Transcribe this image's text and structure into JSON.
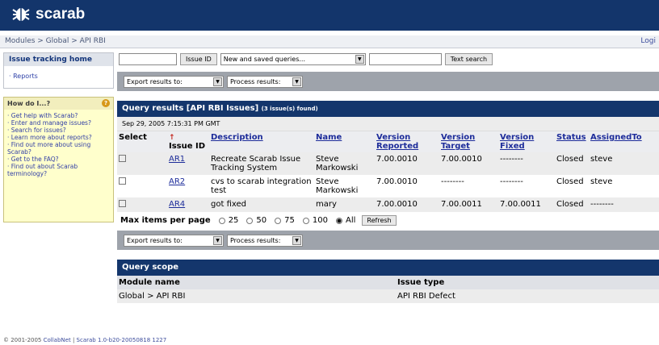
{
  "app": {
    "logo_text": "scarab"
  },
  "breadcrumb": {
    "text": "Modules > Global > API RBI",
    "login": "Logi"
  },
  "sidebar": {
    "home_title": "Issue tracking home",
    "reports_link": "· Reports",
    "help_title": "How do I...?",
    "help_items": [
      "· Get help with Scarab?",
      "· Enter and manage issues?",
      "· Search for issues?",
      "· Learn more about reports?",
      "· Find out more about using Scarab?",
      "· Get to the FAQ?",
      "· Find out about Scarab terminology?"
    ]
  },
  "toolbar": {
    "issue_id_button": "Issue ID",
    "query_select": "New and saved queries...",
    "text_search_button": "Text search"
  },
  "export_bar": {
    "export_select": "Export results to:",
    "process_select": "Process results:"
  },
  "results": {
    "title": "Query results [API RBI Issues]",
    "count": "(3 issue(s) found)",
    "date": "Sep 29, 2005 7:15:31 PM GMT",
    "columns": [
      "Select",
      "Issue ID",
      "Description",
      "Name",
      "Version Reported",
      "Version Target",
      "Version Fixed",
      "Status",
      "AssignedTo"
    ],
    "rows": [
      {
        "id": "AR1",
        "description": "Recreate Scarab Issue Tracking System",
        "name": "Steve Markowski",
        "reported": "7.00.0010",
        "target": "7.00.0010",
        "fixed": "--------",
        "status": "Closed",
        "assigned": "steve"
      },
      {
        "id": "AR2",
        "description": "cvs to scarab integration test",
        "name": "Steve Markowski",
        "reported": "7.00.0010",
        "target": "--------",
        "fixed": "--------",
        "status": "Closed",
        "assigned": "steve"
      },
      {
        "id": "AR4",
        "description": "got fixed",
        "name": "mary",
        "reported": "7.00.0010",
        "target": "7.00.0011",
        "fixed": "7.00.0011",
        "status": "Closed",
        "assigned": "--------"
      }
    ]
  },
  "paging": {
    "label": "Max items per page",
    "options": [
      "25",
      "50",
      "75",
      "100",
      "All"
    ],
    "selected": "All",
    "refresh": "Refresh"
  },
  "scope": {
    "title": "Query scope",
    "col_module": "Module name",
    "col_issue_type": "Issue type",
    "module": "Global > API RBI",
    "issue_type": "API RBI Defect"
  },
  "footer": {
    "copyright": "© 2001-2005",
    "link1": "CollabNet",
    "sep": "|",
    "link2": "Scarab",
    "version": "1.0-b20-20050818 1227"
  }
}
